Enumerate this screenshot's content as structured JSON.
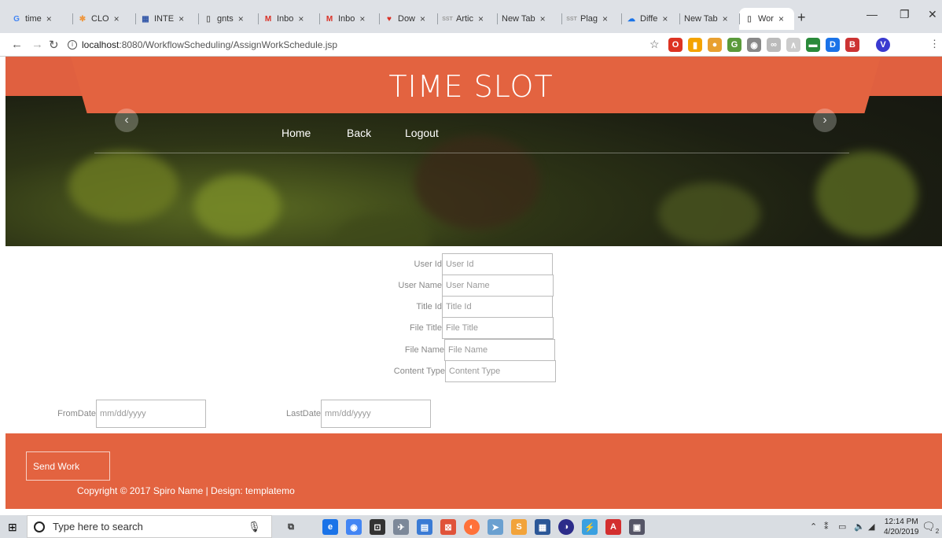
{
  "browser": {
    "tabs": [
      {
        "label": "time",
        "icon": "google-icon",
        "color": "#4285f4"
      },
      {
        "label": "CLO",
        "icon": "colorful-icon",
        "color": "#e94"
      },
      {
        "label": "INTE",
        "icon": "grid-icon",
        "color": "#3357a8"
      },
      {
        "label": "gnts",
        "icon": "page-icon",
        "color": "#666"
      },
      {
        "label": "Inbo",
        "icon": "gmail-icon",
        "color": "#d93025"
      },
      {
        "label": "Inbo",
        "icon": "gmail-icon",
        "color": "#d93025"
      },
      {
        "label": "Dow",
        "icon": "heart-icon",
        "color": "#d93025"
      },
      {
        "label": "Artic",
        "icon": "sst-icon",
        "color": "#999"
      },
      {
        "label": "New Tab",
        "icon": "none",
        "color": "#666"
      },
      {
        "label": "Plag",
        "icon": "sst-icon",
        "color": "#999"
      },
      {
        "label": "Diffe",
        "icon": "cloud-icon",
        "color": "#1a73e8"
      },
      {
        "label": "New Tab",
        "icon": "none",
        "color": "#666"
      },
      {
        "label": "Wor",
        "icon": "page-icon",
        "color": "#666"
      }
    ],
    "close_glyph": "×",
    "new_tab_glyph": "+",
    "url_host": "localhost",
    "url_rest": ":8080/WorkflowScheduling/AssignWorkSchedule.jsp",
    "profile_initial": "V"
  },
  "header": {
    "title": "TIME SLOT",
    "menu": [
      "Home",
      "Back",
      "Logout"
    ]
  },
  "form": {
    "fields": [
      {
        "label": "User Id",
        "placeholder": "User Id"
      },
      {
        "label": "User Name",
        "placeholder": "User Name"
      },
      {
        "label": "Title Id",
        "placeholder": "Title Id"
      },
      {
        "label": "File Title",
        "placeholder": "File Title"
      },
      {
        "label": "File Name",
        "placeholder": "File Name"
      },
      {
        "label": "Content Type",
        "placeholder": "Content Type"
      }
    ],
    "from_date": {
      "label": "FromDate",
      "placeholder": "mm/dd/yyyy"
    },
    "last_date": {
      "label": "LastDate",
      "placeholder": "mm/dd/yyyy"
    }
  },
  "footer": {
    "send_label": "Send Work",
    "copyright": "Copyright © 2017 Spiro Name | Design: templatemo"
  },
  "taskbar": {
    "search_placeholder": "Type here to search",
    "time": "12:14 PM",
    "date": "4/20/2019",
    "notifications": "2"
  },
  "colors": {
    "accent": "#e36340"
  }
}
